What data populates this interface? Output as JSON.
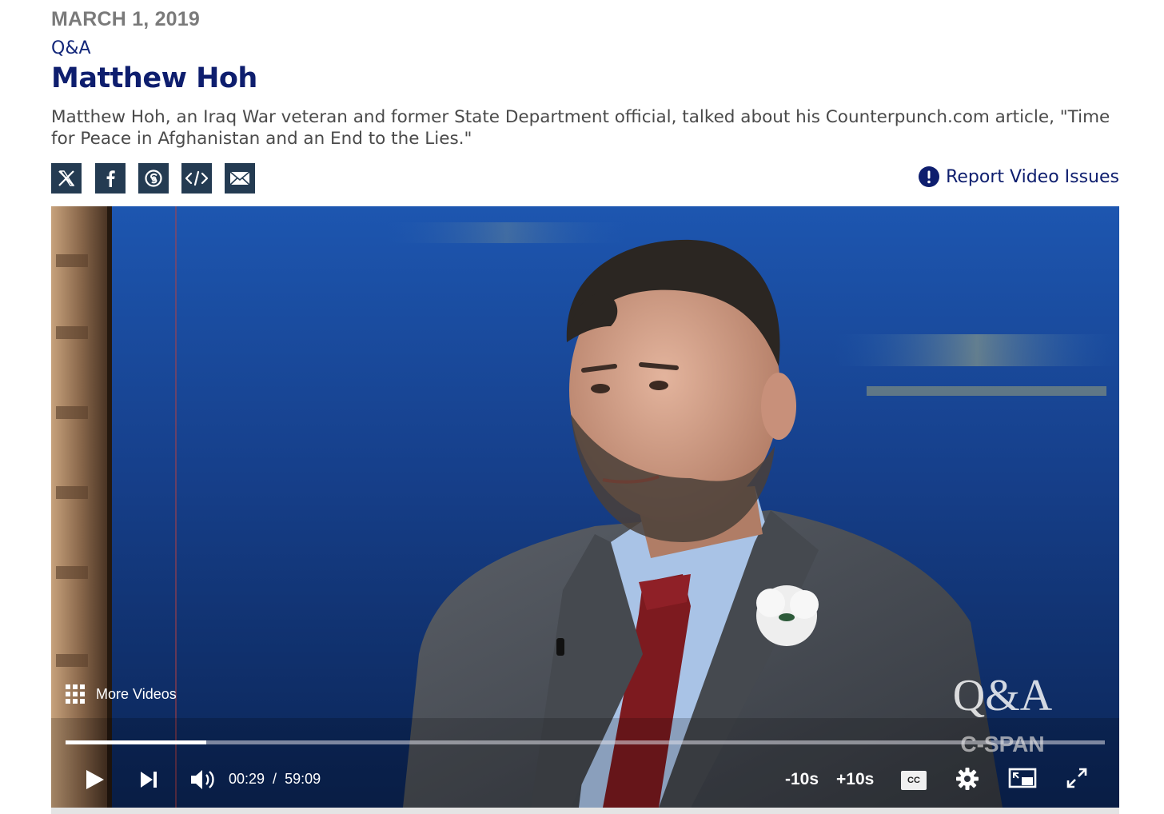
{
  "header": {
    "date": "MARCH 1, 2019",
    "series": "Q&A",
    "title": "Matthew Hoh",
    "description": "Matthew Hoh, an Iraq War veteran and former State Department official, talked about his Counterpunch.com article, \"Time for Peace in Afghanistan and an End to the Lies.\""
  },
  "share": {
    "icons": [
      "x-icon",
      "facebook-icon",
      "threads-icon",
      "embed-icon",
      "email-icon"
    ]
  },
  "report": {
    "label": "Report Video Issues",
    "icon": "exclamation-icon"
  },
  "player": {
    "more_videos_label": "More Videos",
    "watermark_line1": "Q&A",
    "watermark_line2": "C-SPAN",
    "progress_fraction": 0.135,
    "current_time": "00:29",
    "time_separator": "/",
    "duration": "59:09",
    "rewind_label": "-10s",
    "forward_label": "+10s",
    "cc_label": "CC"
  },
  "colors": {
    "brand_navy": "#0e1e6e",
    "share_bg": "#243b52",
    "date_gray": "#7a7a7a"
  }
}
